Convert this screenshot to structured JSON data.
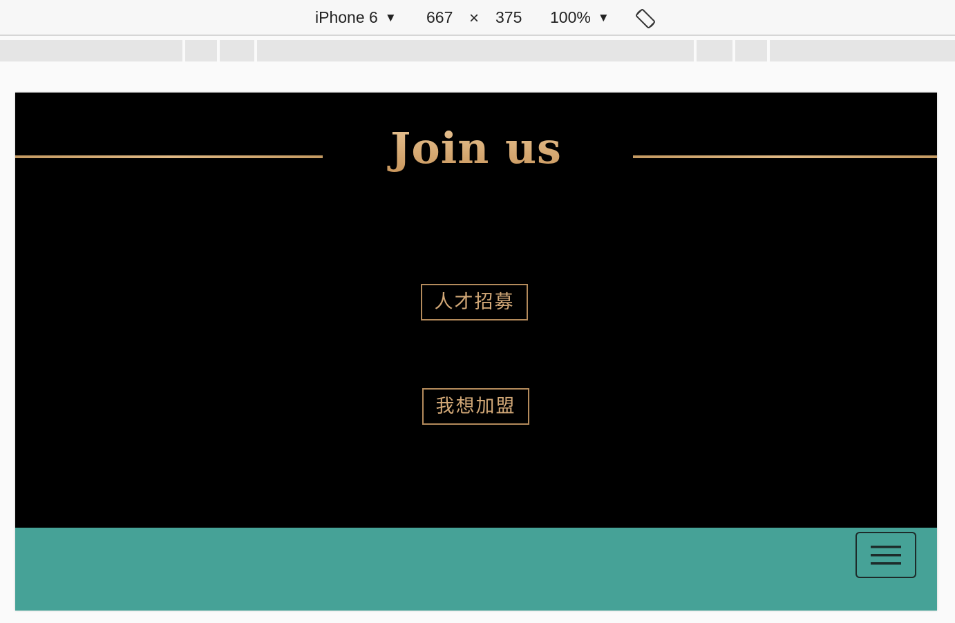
{
  "toolbar": {
    "device": "iPhone 6",
    "width": "667",
    "times": "×",
    "height": "375",
    "zoom": "100%",
    "dropdown_glyph": "▼",
    "rotate_icon": "rotate-icon"
  },
  "page": {
    "title": "Join us",
    "buttons": {
      "recruit": "人才招募",
      "join": "我想加盟"
    },
    "menu_icon": "hamburger-icon"
  },
  "colors": {
    "gold": "#d9ad78",
    "background": "#000000",
    "teal_bar": "#46a297"
  }
}
